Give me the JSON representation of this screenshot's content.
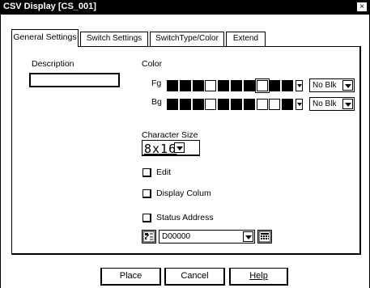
{
  "window": {
    "title": "CSV Display [CS_001]",
    "close_glyph": "×"
  },
  "tabs": [
    {
      "label": "General Settings",
      "active": true
    },
    {
      "label": "Switch Settings",
      "active": false
    },
    {
      "label": "SwitchType/Color",
      "active": false
    },
    {
      "label": "Extend",
      "active": false
    }
  ],
  "general": {
    "description_label": "Description",
    "description_value": "",
    "color_label": "Color",
    "fg_label": "Fg",
    "bg_label": "Bg",
    "fg_swatches": [
      "#000000",
      "#000000",
      "#000000",
      "#ffffff",
      "#000000",
      "#000000",
      "#000000",
      "#ffffff",
      "#000000",
      "#000000"
    ],
    "bg_swatches": [
      "#000000",
      "#000000",
      "#000000",
      "#ffffff",
      "#000000",
      "#000000",
      "#000000",
      "#ffffff",
      "#ffffff",
      "#000000"
    ],
    "fg_blink_value": "No Blk",
    "bg_blink_value": "No Blk",
    "char_size_label": "Character Size",
    "char_size_value": "8x16",
    "edit_label": "Edit",
    "edit_checked": false,
    "display_colum_label": "Display Colum",
    "display_colum_checked": false,
    "status_address_label": "Status Address",
    "status_address_checked": false,
    "address_value": "D00000",
    "address_icon": "word-address-icon",
    "keypad_icon": "keypad-icon"
  },
  "buttons": {
    "place": "Place",
    "cancel": "Cancel",
    "help": "Help"
  }
}
